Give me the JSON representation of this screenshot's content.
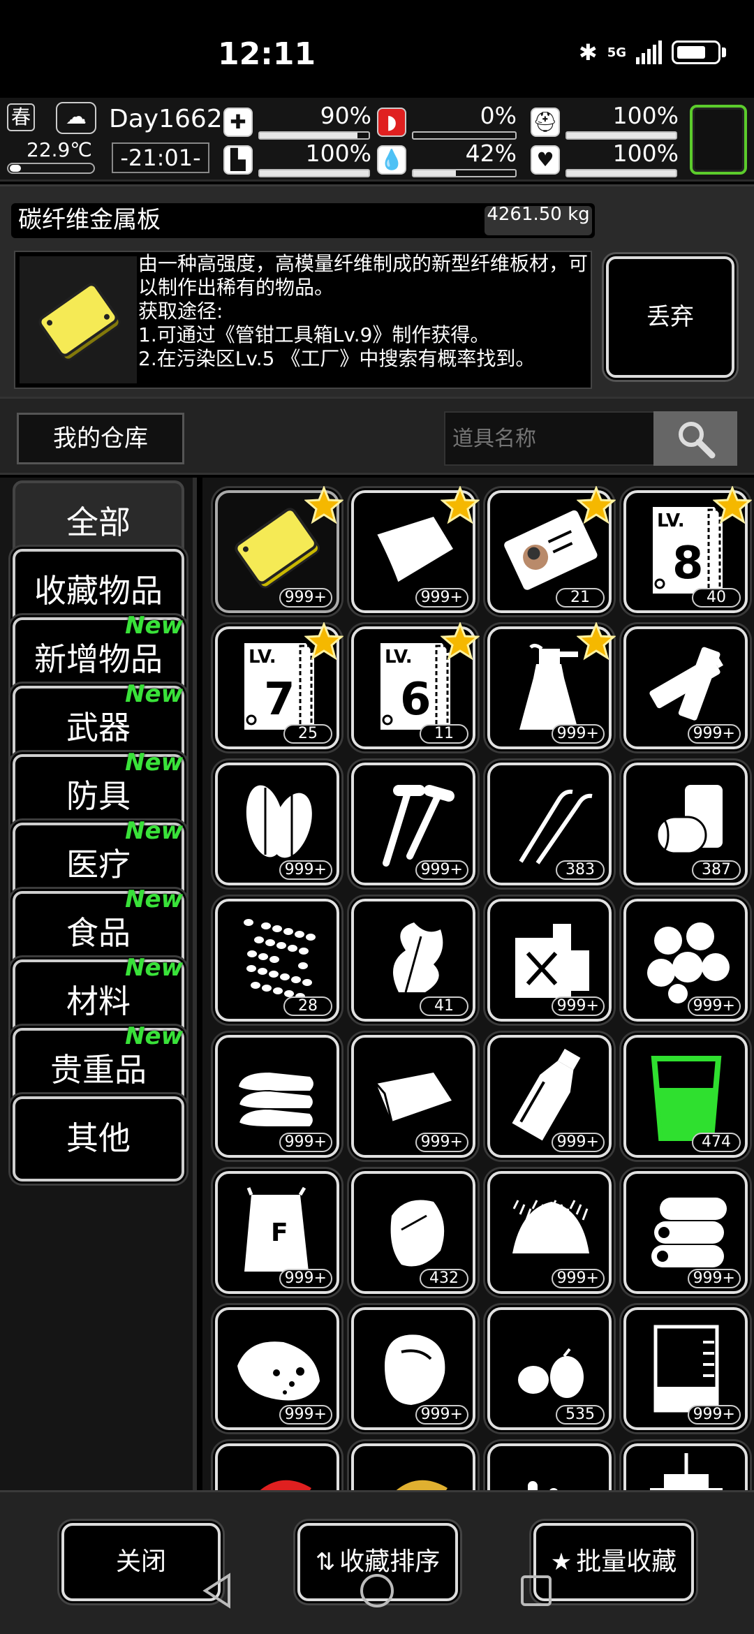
{
  "status_bar": {
    "time": "12:11",
    "network": "5G"
  },
  "hud": {
    "season": "春",
    "temperature": "22.9℃",
    "day": "Day1662",
    "clock": "-21:01-",
    "stats": [
      {
        "name": "health",
        "icon": "medkit-icon",
        "pct": "90%",
        "value": 0.9
      },
      {
        "name": "hunger",
        "icon": "stomach-icon",
        "pct": "0%",
        "value": 0.0
      },
      {
        "name": "armor",
        "icon": "helmet-icon",
        "pct": "100%",
        "value": 1.0
      },
      {
        "name": "stamina",
        "icon": "boot-icon",
        "pct": "100%",
        "value": 1.0
      },
      {
        "name": "thirst",
        "icon": "water-drop-icon",
        "pct": "42%",
        "value": 0.42
      },
      {
        "name": "mood",
        "icon": "heart-icon",
        "pct": "100%",
        "value": 1.0
      }
    ],
    "accent": "#5ccc2c"
  },
  "item_detail": {
    "name": "碳纤维金属板",
    "weight": "4261.50 kg",
    "description": "由一种高强度，高模量纤维制成的新型纤维板材，可以制作出稀有的物品。\n获取途径:\n1.可通过《管钳工具箱Lv.9》制作获得。\n2.在污染区Lv.5 《工厂》中搜索有概率找到。",
    "discard_label": "丢弃"
  },
  "warehouse": {
    "title": "我的仓库",
    "search_placeholder": "道具名称"
  },
  "categories": [
    {
      "label": "全部",
      "new": ""
    },
    {
      "label": "收藏物品",
      "new": ""
    },
    {
      "label": "新增物品",
      "new": "New"
    },
    {
      "label": "武器",
      "new": "New"
    },
    {
      "label": "防具",
      "new": "New"
    },
    {
      "label": "医疗",
      "new": "New"
    },
    {
      "label": "食品",
      "new": "New"
    },
    {
      "label": "材料",
      "new": "New"
    },
    {
      "label": "贵重品",
      "new": "New"
    },
    {
      "label": "其他",
      "new": ""
    }
  ],
  "items": [
    {
      "icon": "metal-plate-icon",
      "count": "999+",
      "fav": true
    },
    {
      "icon": "cloth-sheet-icon",
      "count": "999+",
      "fav": true
    },
    {
      "icon": "id-card-icon",
      "count": "21",
      "fav": true
    },
    {
      "icon": "blueprint-lv8-icon",
      "count": "40",
      "fav": true,
      "lv": "8"
    },
    {
      "icon": "blueprint-lv7-icon",
      "count": "25",
      "fav": true,
      "lv": "7"
    },
    {
      "icon": "blueprint-lv6-icon",
      "count": "11",
      "fav": true,
      "lv": "6"
    },
    {
      "icon": "spray-bottle-icon",
      "count": "999+",
      "fav": true
    },
    {
      "icon": "battery-icon",
      "count": "999+",
      "fav": false
    },
    {
      "icon": "leaves-icon",
      "count": "999+",
      "fav": false
    },
    {
      "icon": "screws-icon",
      "count": "999+",
      "fav": false
    },
    {
      "icon": "wires-icon",
      "count": "383",
      "fav": false
    },
    {
      "icon": "tape-roll-icon",
      "count": "387",
      "fav": false
    },
    {
      "icon": "seeds-icon",
      "count": "28",
      "fav": false
    },
    {
      "icon": "herb-icon",
      "count": "41",
      "fav": false
    },
    {
      "icon": "fuel-can-icon",
      "count": "999+",
      "fav": false
    },
    {
      "icon": "cotton-icon",
      "count": "999+",
      "fav": false
    },
    {
      "icon": "folded-cloth-icon",
      "count": "999+",
      "fav": false
    },
    {
      "icon": "fabric-icon",
      "count": "999+",
      "fav": false
    },
    {
      "icon": "bottle-icon",
      "count": "999+",
      "fav": false
    },
    {
      "icon": "green-beaker-icon",
      "count": "474",
      "fav": false
    },
    {
      "icon": "flour-bag-icon",
      "count": "999+",
      "fav": false
    },
    {
      "icon": "raw-meat-icon",
      "count": "432",
      "fav": false
    },
    {
      "icon": "fiber-pile-icon",
      "count": "999+",
      "fav": false
    },
    {
      "icon": "logs-icon",
      "count": "999+",
      "fav": false
    },
    {
      "icon": "ore-rock-icon",
      "count": "999+",
      "fav": false
    },
    {
      "icon": "steak-icon",
      "count": "999+",
      "fav": false
    },
    {
      "icon": "eggs-icon",
      "count": "535",
      "fav": false
    },
    {
      "icon": "beaker-icon",
      "count": "999+",
      "fav": false
    },
    {
      "icon": "red-leaf-icon",
      "count": "",
      "fav": false
    },
    {
      "icon": "yellow-leaf-icon",
      "count": "",
      "fav": false
    },
    {
      "icon": "pills-icon",
      "count": "",
      "fav": false
    },
    {
      "icon": "cup-icon",
      "count": "",
      "fav": false
    }
  ],
  "bottom": {
    "close_label": "关闭",
    "sort_label": "收藏排序",
    "batch_label": "批量收藏"
  }
}
